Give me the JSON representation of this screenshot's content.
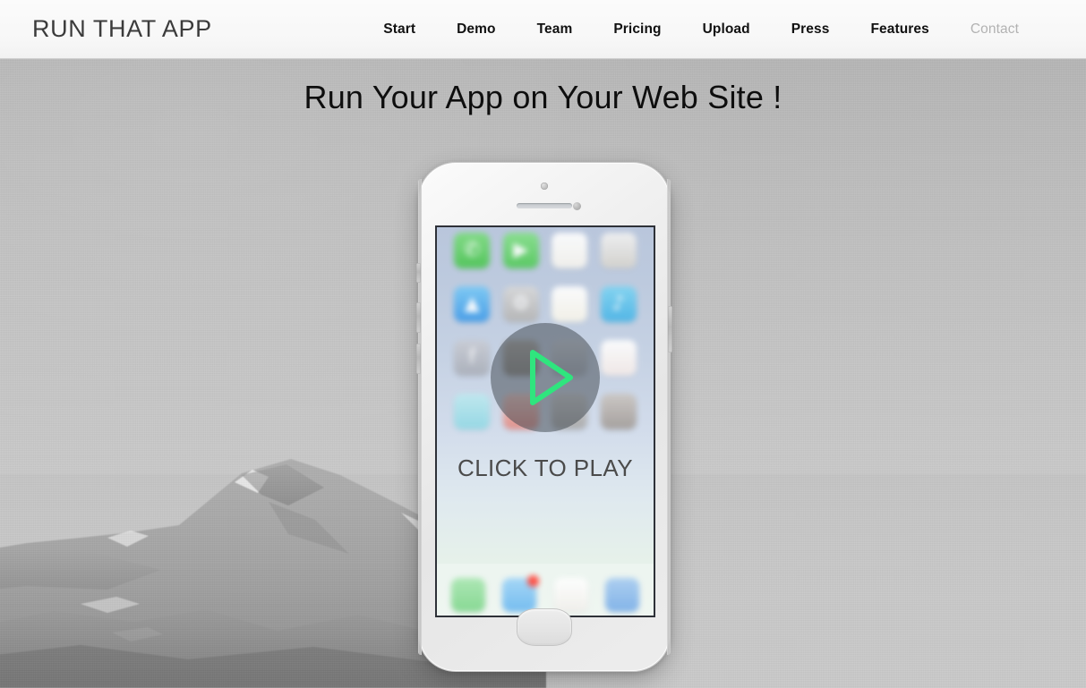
{
  "header": {
    "brand": "RUN THAT APP",
    "nav": [
      {
        "label": "Start",
        "state": "active"
      },
      {
        "label": "Demo",
        "state": "active"
      },
      {
        "label": "Team",
        "state": "active"
      },
      {
        "label": "Pricing",
        "state": "active"
      },
      {
        "label": "Upload",
        "state": "active"
      },
      {
        "label": "Press",
        "state": "active"
      },
      {
        "label": "Features",
        "state": "active"
      },
      {
        "label": "Contact",
        "state": "muted"
      }
    ]
  },
  "hero": {
    "title": "Run Your App on Your Web Site !",
    "background": "grayscale mountain photo"
  },
  "phone": {
    "player": {
      "play_icon": "play-triangle-icon",
      "caption": "CLICK TO PLAY",
      "accent_color": "#2fe57e",
      "circle_color": "rgba(66,72,80,0.52)",
      "caption_color": "#4b4b4b"
    },
    "screen": {
      "wallpaper": "blurred-ios-homescreen",
      "apps": [
        {
          "name": "phone-app-icon",
          "glyph": "✆",
          "color1": "#7ddc7f",
          "color2": "#4cc552"
        },
        {
          "name": "messages-app-icon",
          "glyph": "▶",
          "color1": "#86e08a",
          "color2": "#53c95a"
        },
        {
          "name": "notes-app-icon",
          "glyph": "",
          "color1": "#ffffff",
          "color2": "#f4f2ec"
        },
        {
          "name": "clock-app-icon",
          "glyph": "",
          "color1": "#f2f2f2",
          "color2": "#d4d2cc"
        },
        {
          "name": "appstore-app-icon",
          "glyph": "▲",
          "color1": "#79c9f5",
          "color2": "#3f9ae8"
        },
        {
          "name": "settings-app-icon",
          "glyph": "⚙",
          "color1": "#d8d8d8",
          "color2": "#b4b4b4"
        },
        {
          "name": "photos-app-icon",
          "glyph": "",
          "color1": "#ffffff",
          "color2": "#f6f3e8"
        },
        {
          "name": "music-app-icon",
          "glyph": "♪",
          "color1": "#7fd4f2",
          "color2": "#49b4e6"
        },
        {
          "name": "facebook-app-icon",
          "glyph": "f",
          "color1": "#c9ccd4",
          "color2": "#a9aeb8"
        },
        {
          "name": "instagram-app-icon",
          "glyph": "",
          "color1": "#b0aca6",
          "color2": "#8c8882"
        },
        {
          "name": "contacts-app-icon",
          "glyph": "",
          "color1": "#cfd4dc",
          "color2": "#aab0ba"
        },
        {
          "name": "news-app-icon",
          "glyph": "",
          "color1": "#ffffff",
          "color2": "#f2e9e6"
        },
        {
          "name": "skype-app-icon",
          "glyph": "",
          "color1": "#bfe9ef",
          "color2": "#91d8e4"
        },
        {
          "name": "pinterest-app-icon",
          "glyph": "",
          "color1": "#f2c7c0",
          "color2": "#e08b84"
        },
        {
          "name": "camera-app-icon",
          "glyph": "",
          "color1": "#cfcfcf",
          "color2": "#a8a8a8"
        },
        {
          "name": "podcast-app-icon",
          "glyph": "",
          "color1": "#cbc6c2",
          "color2": "#a29c98"
        }
      ],
      "dock": [
        {
          "name": "whatsapp-dock-icon",
          "glyph": "",
          "color1": "#a8e6b0",
          "color2": "#7fd68c",
          "badge": false
        },
        {
          "name": "mail-dock-icon",
          "glyph": "",
          "color1": "#9fd4f7",
          "color2": "#6bb8f0",
          "badge": true
        },
        {
          "name": "chrome-dock-icon",
          "glyph": "",
          "color1": "#ffffff",
          "color2": "#f0eeea",
          "badge": false
        },
        {
          "name": "twitter-dock-icon",
          "glyph": "",
          "color1": "#a8ccf0",
          "color2": "#79aee8",
          "badge": false
        }
      ]
    },
    "hardware": {
      "camera": "front-camera",
      "earpiece": "earpiece-speaker",
      "sensor": "proximity-sensor",
      "home": "home-button",
      "volume_up": "volume-up-button",
      "volume_down": "volume-down-button",
      "mute": "mute-switch",
      "power": "power-button"
    }
  }
}
